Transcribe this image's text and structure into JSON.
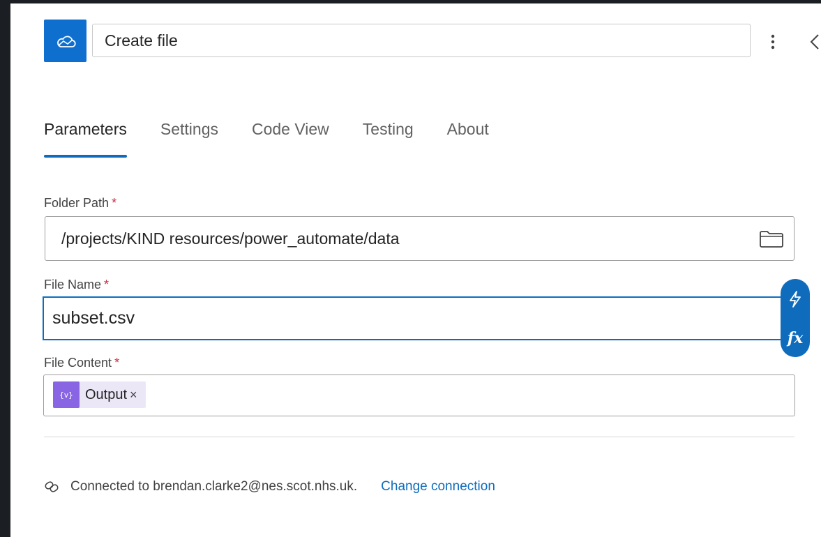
{
  "header": {
    "title": "Create file",
    "app_icon": "onedrive-cloud-icon",
    "more_icon": "more-vertical-icon",
    "collapse_icon": "chevron-left-icon"
  },
  "tabs": [
    {
      "label": "Parameters",
      "active": true
    },
    {
      "label": "Settings",
      "active": false
    },
    {
      "label": "Code View",
      "active": false
    },
    {
      "label": "Testing",
      "active": false
    },
    {
      "label": "About",
      "active": false
    }
  ],
  "fields": {
    "folder_path": {
      "label": "Folder Path",
      "required_mark": "*",
      "value": "/projects/KIND resources/power_automate/data",
      "icon": "folder-icon"
    },
    "file_name": {
      "label": "File Name",
      "required_mark": "*",
      "value": "subset.csv"
    },
    "file_content": {
      "label": "File Content",
      "required_mark": "*",
      "token": {
        "icon_text": "{v}",
        "label": "Output",
        "remove": "×"
      }
    }
  },
  "dynamic_tools": {
    "lightning_icon": "lightning-icon",
    "fx_label": "fx"
  },
  "connection": {
    "text": "Connected to brendan.clarke2@nes.scot.nhs.uk.",
    "link": "Change connection",
    "icon": "link-icon"
  },
  "colors": {
    "accent": "#0f6cbd",
    "token_icon": "#8a65e3",
    "token_bg": "#ece7f7",
    "required": "#c4314b",
    "app_icon_bg": "#0f6fcf"
  }
}
